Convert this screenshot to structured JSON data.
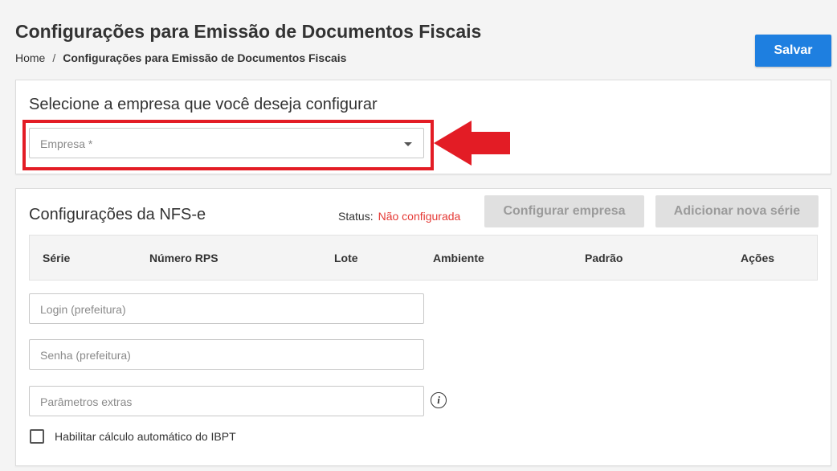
{
  "header": {
    "title": "Configurações para Emissão de Documentos Fiscais",
    "save_label": "Salvar"
  },
  "breadcrumb": {
    "home": "Home",
    "separator": "/",
    "current": "Configurações para Emissão de Documentos Fiscais"
  },
  "company_section": {
    "title": "Selecione a empresa que você deseja configurar",
    "select_placeholder": "Empresa *",
    "highlight_color": "#e31c25"
  },
  "nfse_section": {
    "title": "Configurações da NFS-e",
    "status_label": "Status:",
    "status_value": "Não configurada",
    "status_color": "#e53935",
    "configure_button": "Configurar empresa",
    "add_series_button": "Adicionar nova série",
    "table_headers": [
      "Série",
      "Número RPS",
      "Lote",
      "Ambiente",
      "Padrão",
      "Ações"
    ],
    "login_placeholder": "Login (prefeitura)",
    "password_placeholder": "Senha (prefeitura)",
    "extra_params_placeholder": "Parâmetros extras",
    "info_icon": "info-icon",
    "ibpt_checkbox_label": "Habilitar cálculo automático do IBPT",
    "ibpt_checked": false
  },
  "colors": {
    "primary": "#1e7fe0",
    "disabled_bg": "#e0e0e0",
    "disabled_text": "#9b9b9b"
  }
}
